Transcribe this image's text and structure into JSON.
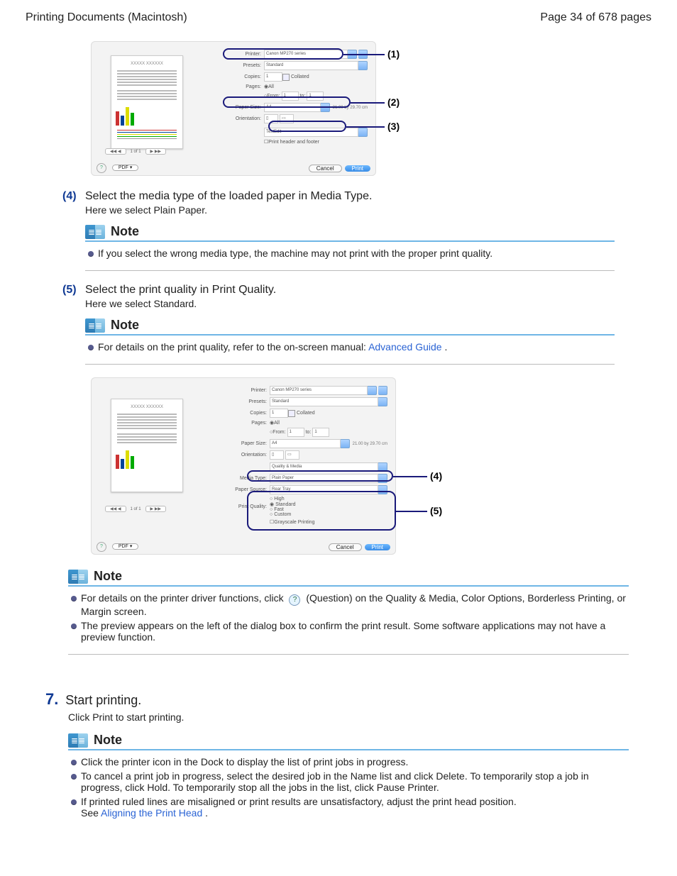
{
  "header": {
    "title": "Printing Documents (Macintosh)",
    "page": "Page 34 of 678 pages"
  },
  "shot_common": {
    "printer_label": "Printer:",
    "printer_value": "Canon MP270 series",
    "presets_label": "Presets:",
    "presets_value": "Standard",
    "copies_label": "Copies:",
    "copies_value": "1",
    "collated": "Collated",
    "pages_label": "Pages:",
    "pages_all": "All",
    "pages_from_label": "From:",
    "pages_from": "1",
    "pages_to_label": "to:",
    "pages_to": "1",
    "papersize_label": "Paper Size:",
    "papersize_value": "A4",
    "papersize_dim": "21.00 by 29.70 cm",
    "orientation_label": "Orientation:",
    "help_glyph": "?",
    "pdf_label": "PDF ▾",
    "cancel": "Cancel",
    "print": "Print",
    "pager_txt": "1 of 1",
    "preview_title": "XXXXX XXXXXX"
  },
  "shot1": {
    "section_value": "TextEdit",
    "chk_header_footer": "Print header and footer",
    "num1": "(1)",
    "num2": "(2)",
    "num3": "(3)"
  },
  "shot2": {
    "section_value": "Quality & Media",
    "mt_label": "Media Type:",
    "mt_value": "Plain Paper",
    "ps_label": "Paper Source:",
    "ps_value": "Rear Tray",
    "pq_label": "Print Quality:",
    "pq_high": "High",
    "pq_standard": "Standard",
    "pq_fast": "Fast",
    "pq_custom": "Custom",
    "grayscale": "Grayscale Printing",
    "num4": "(4)",
    "num5": "(5)"
  },
  "step4": {
    "id": "(4)",
    "text": "Select the media type of the loaded paper in Media Type.",
    "sub": "Here we select Plain Paper."
  },
  "step5": {
    "id": "(5)",
    "text": "Select the print quality in Print Quality.",
    "sub": "Here we select Standard."
  },
  "note1": {
    "title": "Note",
    "items": [
      "If you select the wrong media type, the machine may not print with the proper print quality."
    ]
  },
  "note2": {
    "title": "Note",
    "item_prefix": "For details on the print quality, refer to the on-screen manual: ",
    "link": "Advanced Guide",
    "suffix": "."
  },
  "note3": {
    "title": "Note",
    "item1_a": "For details on the printer driver functions, click ",
    "item1_b": " (Question) on the Quality & Media, Color Options, Borderless Printing, or Margin screen.",
    "item2": "The preview appears on the left of the dialog box to confirm the print result. Some software applications may not have a preview function."
  },
  "step7": {
    "num": "7.",
    "title": "Start printing.",
    "sub": "Click Print to start printing."
  },
  "note4": {
    "title": "Note",
    "item1": "Click the printer icon in the Dock to display the list of print jobs in progress.",
    "item2": "To cancel a print job in progress, select the desired job in the Name list and click Delete. To temporarily stop a job in progress, click Hold. To temporarily stop all the jobs in the list, click Pause Printer.",
    "item3_a": "If printed ruled lines are misaligned or print results are unsatisfactory, adjust the print head position.",
    "item3_b": "See ",
    "item3_link": "Aligning the Print Head",
    "item3_c": "."
  }
}
